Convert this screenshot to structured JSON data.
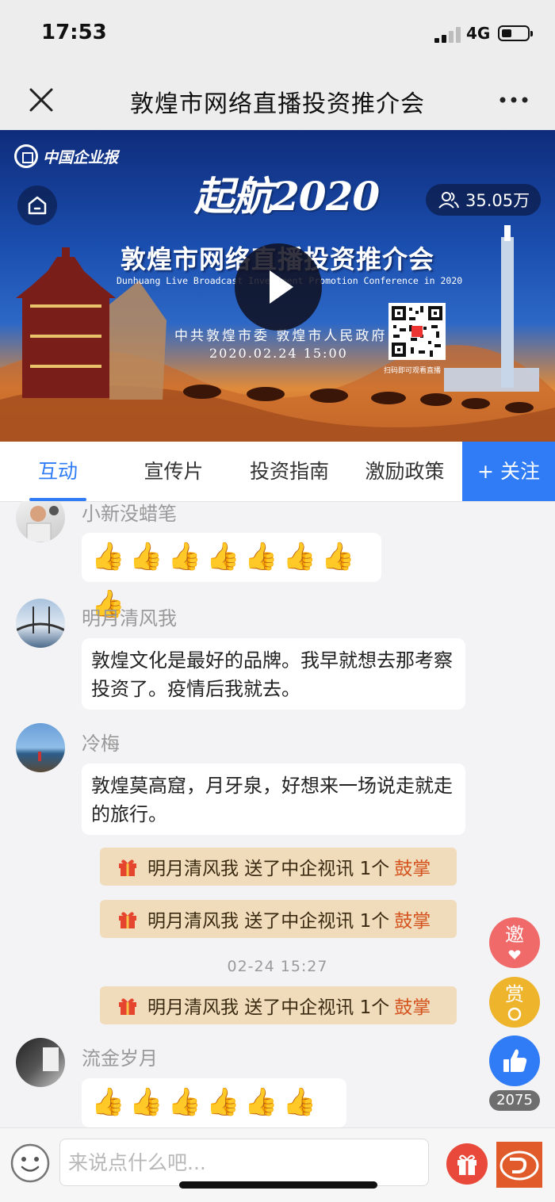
{
  "status_bar": {
    "time": "17:53",
    "network": "4G"
  },
  "navbar": {
    "title": "敦煌市网络直播投资推介会"
  },
  "banner": {
    "logo_text": "中国企业报",
    "viewer_count": "35.05万",
    "headline": "起航2020",
    "title": "敦煌市网络直播投资推介会",
    "subtitle": "Dunhuang Live  Broadcast  Investment Promotion Conference in 2020",
    "organizers": "中共敦煌市委  敦煌市人民政府",
    "datetime": "2020.02.24   15:00",
    "qr_caption": "扫码即可观看直播"
  },
  "tabs": [
    {
      "label": "互动",
      "active": true
    },
    {
      "label": "宣传片",
      "active": false
    },
    {
      "label": "投资指南",
      "active": false
    },
    {
      "label": "激励政策",
      "active": false
    }
  ],
  "follow_label": "+ 关注",
  "messages": [
    {
      "user": "小新没蜡笔",
      "text": "👍👍👍👍👍👍👍👍"
    },
    {
      "user": "明月清风我",
      "text": "敦煌文化是最好的品牌。我早就想去那考察投资了。疫情后我就去。"
    },
    {
      "user": "冷梅",
      "text": "敦煌莫高窟，月牙泉，好想来一场说走就走的旅行。"
    },
    {
      "user": "流金岁月",
      "text": "👍👍👍👍👍👍👍"
    }
  ],
  "gifts": [
    {
      "text": "明月清风我 送了中企视讯 1个",
      "item": "鼓掌"
    },
    {
      "text": "明月清风我 送了中企视讯 1个",
      "item": "鼓掌"
    },
    {
      "text": "明月清风我 送了中企视讯 1个",
      "item": "鼓掌"
    }
  ],
  "timestamp": "02-24 15:27",
  "fab": {
    "invite": "邀",
    "reward": "赏",
    "like_count": "2075"
  },
  "input": {
    "placeholder": "来说点什么吧..."
  },
  "colors": {
    "accent": "#2f7cf6",
    "gift_bg": "#f0dcbb",
    "gift_keyword": "#d4531f"
  }
}
